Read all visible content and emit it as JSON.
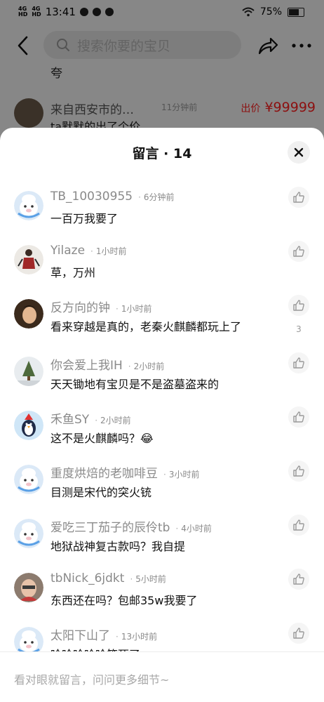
{
  "status_bar": {
    "network_1": "4G",
    "network_1b": "HD",
    "network_2": "4G",
    "network_2b": "HD",
    "time": "13:41",
    "battery": "75%"
  },
  "top_bar": {
    "search_placeholder": "搜索你要的宝贝",
    "icons": [
      "back-arrow-icon",
      "search-icon",
      "share-icon",
      "more-icon"
    ]
  },
  "background": {
    "partial_text": "夸",
    "offer": {
      "name": "来自西安市的…",
      "time": "11分钟前",
      "price_label": "出价",
      "price": "¥99999",
      "text": "ta默默的出了个价"
    }
  },
  "sheet": {
    "title": "留言 · 14"
  },
  "comments": [
    {
      "name": "TB_10030955",
      "time": "6分钟前",
      "text": "一百万我要了",
      "likes": ""
    },
    {
      "name": "Yilaze",
      "time": "1小时前",
      "text": "草，万州",
      "likes": ""
    },
    {
      "name": "反方向的钟",
      "time": "1小时前",
      "text": "看来穿越是真的，老秦火麒麟都玩上了",
      "likes": "3"
    },
    {
      "name": "你会爱上我IH",
      "time": "2小时前",
      "text": "天天锄地有宝贝是不是盗墓盗来的",
      "likes": ""
    },
    {
      "name": "禾鱼SY",
      "time": "2小时前",
      "text": "这不是火麒麟吗？😂",
      "likes": ""
    },
    {
      "name": "重度烘焙的老咖啡豆",
      "time": "3小时前",
      "text": "目测是宋代的突火铳",
      "likes": ""
    },
    {
      "name": "爱吃三丁茄子的辰伶tb",
      "time": "4小时前",
      "text": "地狱战神复古款吗？我自提",
      "likes": ""
    },
    {
      "name": "tbNick_6jdkt",
      "time": "5小时前",
      "text": "东西还在吗？包邮35w我要了",
      "likes": ""
    },
    {
      "name": "太阳下山了",
      "time": "13小时前",
      "text": "哈哈哈哈哈笑死了",
      "likes": ""
    }
  ],
  "input": {
    "placeholder": "看对眼就留言，问问更多细节~"
  },
  "colors": {
    "price_red": "#ff2020",
    "overlay": "rgba(0,0,0,0.45)",
    "muted_text": "#8a8a8a"
  }
}
